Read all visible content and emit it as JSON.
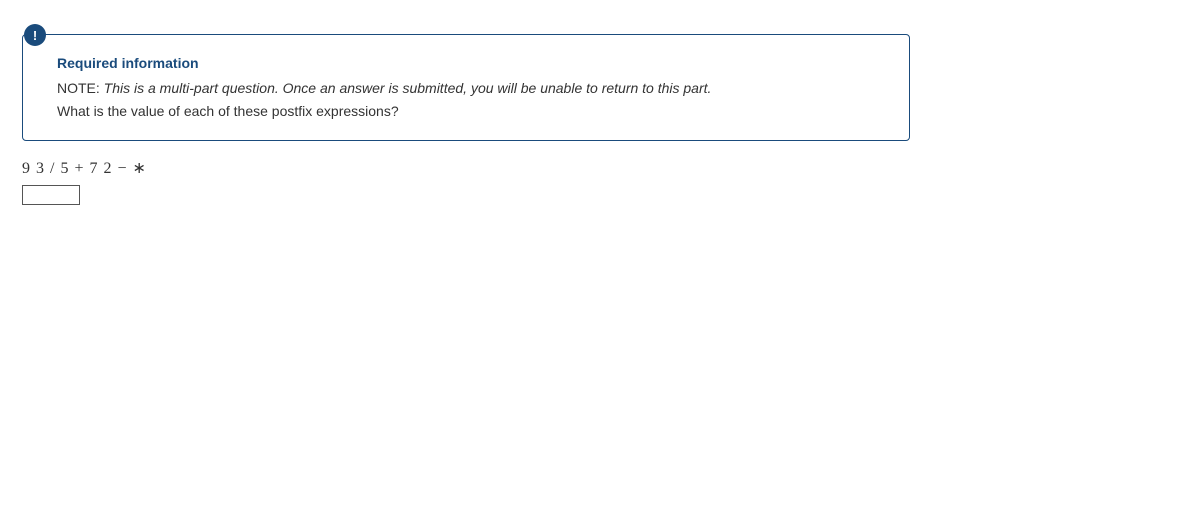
{
  "info_icon_glyph": "!",
  "heading": "Required information",
  "note_prefix": "NOTE:",
  "note_body": "This is a multi-part question. Once an answer is submitted, you will be unable to return to this part.",
  "question": "What is the value of each of these postfix expressions?",
  "expression": "9 3 / 5  +  7 2  −  ∗",
  "answer_value": ""
}
